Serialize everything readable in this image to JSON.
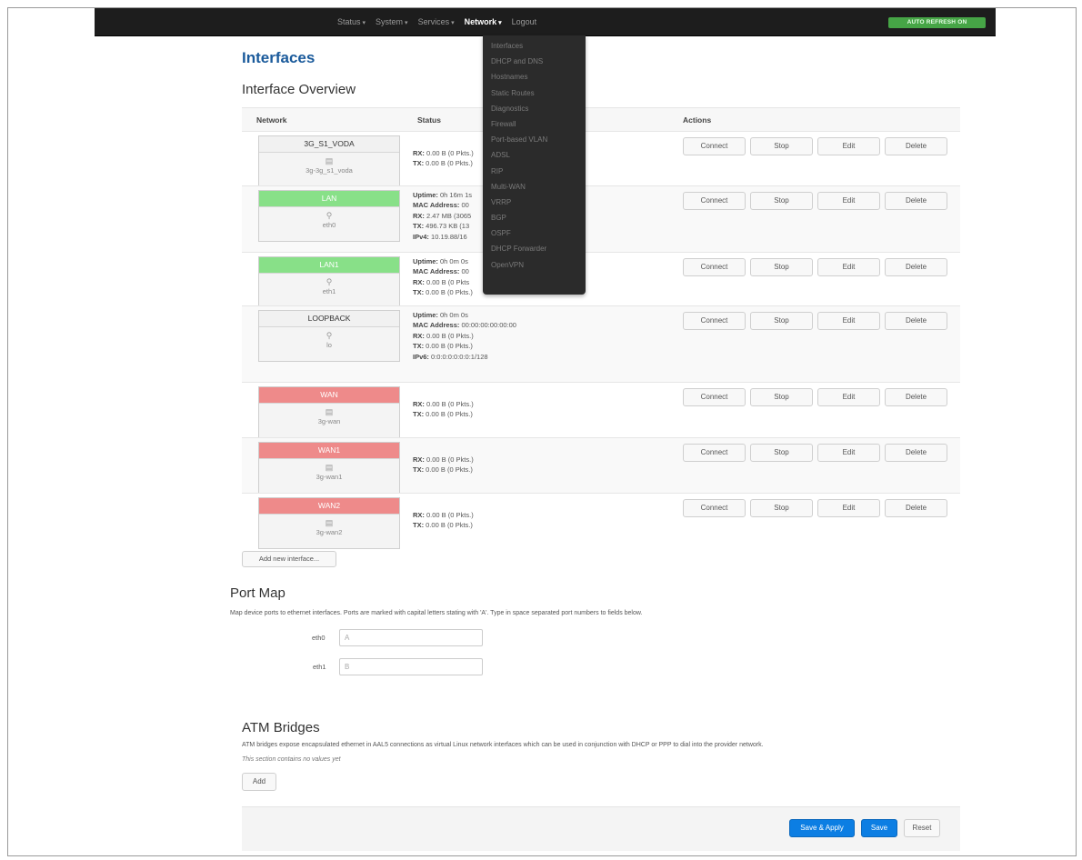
{
  "topbar": {
    "menu": [
      {
        "label": "Status",
        "caret": "▾",
        "active": false
      },
      {
        "label": "System",
        "caret": "▾",
        "active": false
      },
      {
        "label": "Services",
        "caret": "▾",
        "active": false
      },
      {
        "label": "Network",
        "caret": "▾",
        "active": true
      },
      {
        "label": "Logout",
        "caret": "",
        "active": false
      }
    ],
    "autorefresh": "AUTO REFRESH ON"
  },
  "network_menu": [
    "Interfaces",
    "DHCP and DNS",
    "Hostnames",
    "Static Routes",
    "Diagnostics",
    "Firewall",
    "Port-based VLAN",
    "ADSL",
    "RIP",
    "Multi-WAN",
    "VRRP",
    "BGP",
    "OSPF",
    "DHCP Forwarder",
    "OpenVPN"
  ],
  "page": {
    "title": "Interfaces",
    "overview_heading": "Interface Overview",
    "columns": {
      "network": "Network",
      "status": "Status",
      "actions": "Actions"
    },
    "interfaces": [
      {
        "name": "3G_S1_VODA",
        "device": "3g-3g_s1_voda",
        "icon": "modem-icon",
        "status": [
          {
            "k": "RX:",
            "v": " 0.00 B (0 Pkts.)"
          },
          {
            "k": "TX:",
            "v": " 0.00 B (0 Pkts.)"
          }
        ]
      },
      {
        "name": "LAN",
        "device": "eth0",
        "icon": "ethernet-icon",
        "status": [
          {
            "k": "Uptime:",
            "v": " 0h 16m 1s"
          },
          {
            "k": "MAC Address:",
            "v": " 00"
          },
          {
            "k": "RX:",
            "v": " 2.47 MB (3065"
          },
          {
            "k": "TX:",
            "v": " 496.73 KB (13"
          },
          {
            "k": "IPv4:",
            "v": " 10.19.88/16"
          }
        ]
      },
      {
        "name": "LAN1",
        "device": "eth1",
        "icon": "ethernet-icon",
        "status": [
          {
            "k": "Uptime:",
            "v": " 0h 0m 0s"
          },
          {
            "k": "MAC Address:",
            "v": " 00"
          },
          {
            "k": "RX:",
            "v": " 0.00 B (0 Pkts"
          },
          {
            "k": "TX:",
            "v": " 0.00 B (0 Pkts.)"
          }
        ]
      },
      {
        "name": "LOOPBACK",
        "device": "lo",
        "icon": "ethernet-icon",
        "status": [
          {
            "k": "Uptime:",
            "v": " 0h 0m 0s"
          },
          {
            "k": "MAC Address:",
            "v": " 00:00:00:00:00:00"
          },
          {
            "k": "RX:",
            "v": " 0.00 B (0 Pkts.)"
          },
          {
            "k": "TX:",
            "v": " 0.00 B (0 Pkts.)"
          },
          {
            "k": "IPv6:",
            "v": " 0:0:0:0:0:0:0:1/128"
          }
        ]
      },
      {
        "name": "WAN",
        "device": "3g-wan",
        "icon": "modem-icon",
        "status": [
          {
            "k": "RX:",
            "v": " 0.00 B (0 Pkts.)"
          },
          {
            "k": "TX:",
            "v": " 0.00 B (0 Pkts.)"
          }
        ]
      },
      {
        "name": "WAN1",
        "device": "3g-wan1",
        "icon": "modem-icon",
        "status": [
          {
            "k": "RX:",
            "v": " 0.00 B (0 Pkts.)"
          },
          {
            "k": "TX:",
            "v": " 0.00 B (0 Pkts.)"
          }
        ]
      },
      {
        "name": "WAN2",
        "device": "3g-wan2",
        "icon": "modem-icon",
        "status": [
          {
            "k": "RX:",
            "v": " 0.00 B (0 Pkts.)"
          },
          {
            "k": "TX:",
            "v": " 0.00 B (0 Pkts.)"
          }
        ]
      }
    ],
    "action_labels": [
      "Connect",
      "Stop",
      "Edit",
      "Delete"
    ],
    "add_interface": "Add new interface...",
    "portmap": {
      "heading": "Port Map",
      "description": "Map device ports to ethernet interfaces. Ports are marked with capital letters stating with 'A'. Type in space separated port numbers to fields below.",
      "eth0_label": "eth0",
      "eth0_value": "A",
      "eth1_label": "eth1",
      "eth1_value": "B"
    },
    "atm": {
      "heading": "ATM Bridges",
      "description": "ATM bridges expose encapsulated ethernet in AAL5 connections as virtual Linux network interfaces which can be used in conjunction with DHCP or PPP to dial into the provider network.",
      "empty": "This section contains no values yet",
      "add": "Add"
    },
    "footer": {
      "save_apply": "Save & Apply",
      "save": "Save",
      "reset": "Reset"
    }
  }
}
